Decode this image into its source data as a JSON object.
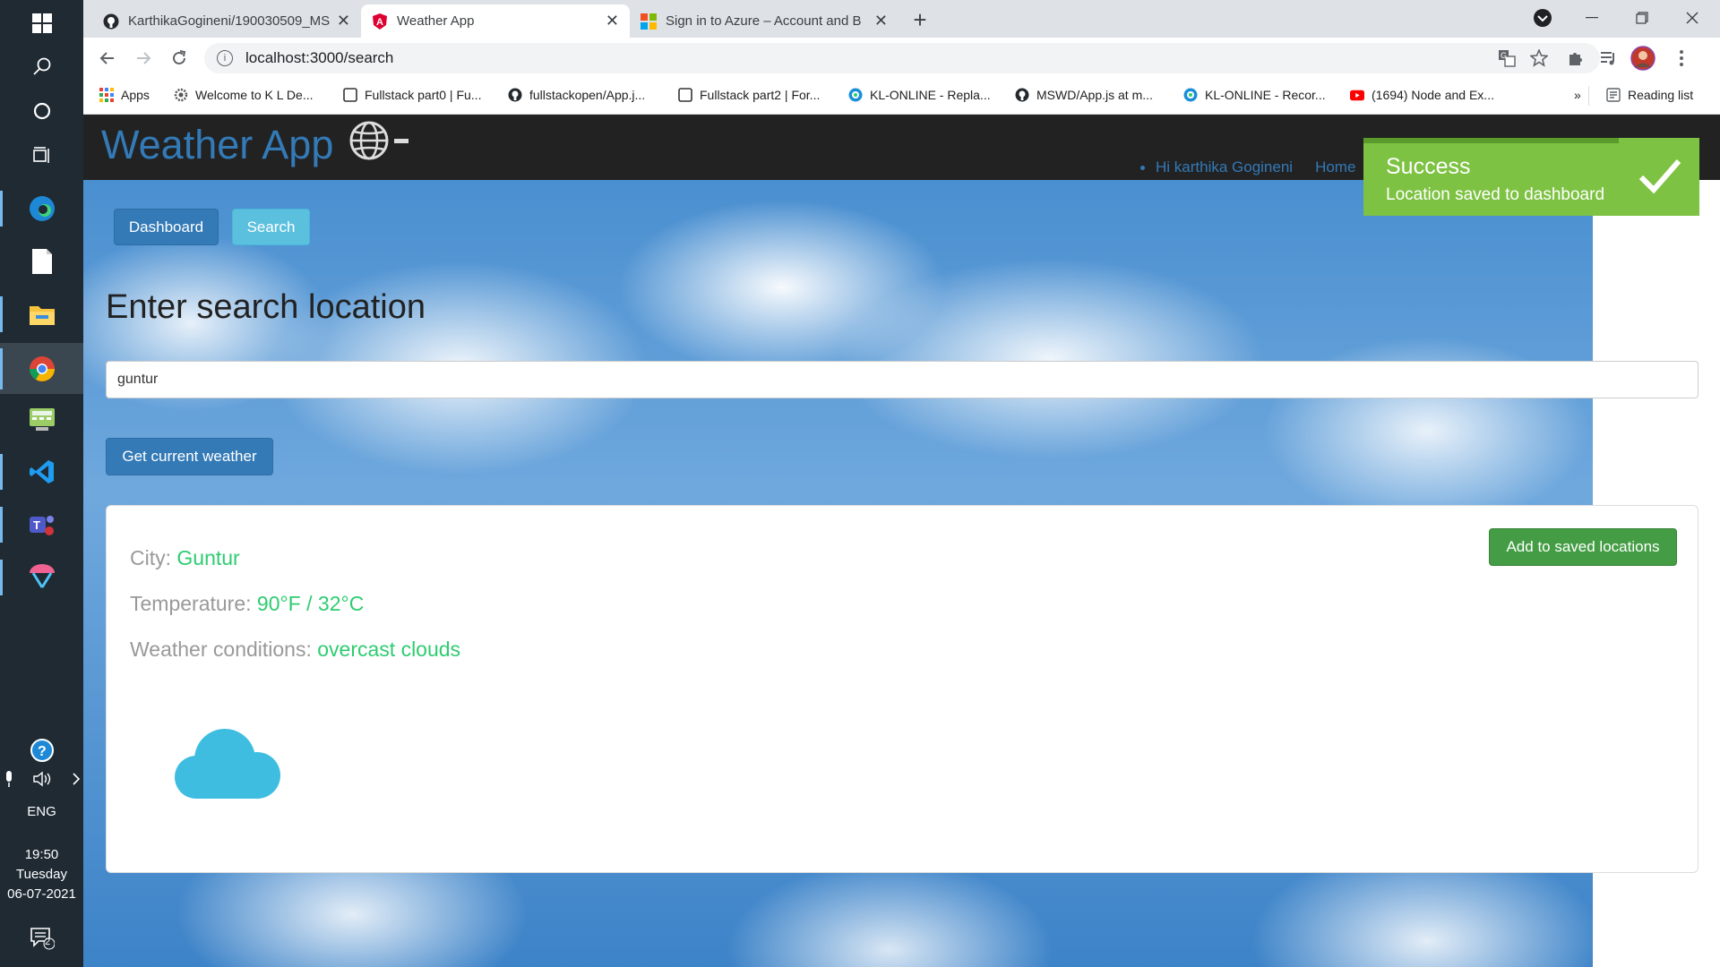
{
  "taskbar": {
    "language": "ENG",
    "time": "19:50",
    "day": "Tuesday",
    "date": "06-07-2021",
    "notification_count": "2"
  },
  "browser": {
    "tabs": [
      {
        "title": "KarthikaGogineni/190030509_MS",
        "icon": "github-icon",
        "active": false
      },
      {
        "title": "Weather App",
        "icon": "angular-icon",
        "active": true
      },
      {
        "title": "Sign in to Azure – Account and B",
        "icon": "microsoft-icon",
        "active": false
      }
    ],
    "url": "localhost:3000/search",
    "bookmarks": [
      {
        "label": "Apps",
        "icon": "apps-grid-icon"
      },
      {
        "label": "Welcome to K L De...",
        "icon": "gear-icon"
      },
      {
        "label": "Fullstack part0 | Fu...",
        "icon": "page-icon"
      },
      {
        "label": "fullstackopen/App.j...",
        "icon": "github-icon"
      },
      {
        "label": "Fullstack part2 | For...",
        "icon": "page-icon"
      },
      {
        "label": "KL-ONLINE - Repla...",
        "icon": "kl-online-icon"
      },
      {
        "label": "MSWD/App.js at m...",
        "icon": "github-icon"
      },
      {
        "label": "KL-ONLINE - Recor...",
        "icon": "kl-online-icon"
      },
      {
        "label": "(1694) Node and Ex...",
        "icon": "youtube-icon"
      }
    ],
    "more_bookmarks": "»",
    "reading_list": "Reading list"
  },
  "app": {
    "brand": "Weather App",
    "greeting": "Hi karthika Gogineni",
    "nav_home": "Home",
    "dashboard_button": "Dashboard",
    "search_button": "Search",
    "heading": "Enter search location",
    "search_value": "guntur",
    "get_weather_button": "Get current weather",
    "result": {
      "city_label": "City:",
      "city": "Guntur",
      "temperature_label": "Temperature:",
      "temperature": "90°F / 32°C",
      "conditions_label": "Weather conditions:",
      "conditions": "overcast clouds",
      "add_button": "Add to saved locations",
      "weather_icon": "cloud-icon"
    },
    "toast": {
      "title": "Success",
      "message": "Location saved to dashboard",
      "color": "#7dc242"
    }
  }
}
